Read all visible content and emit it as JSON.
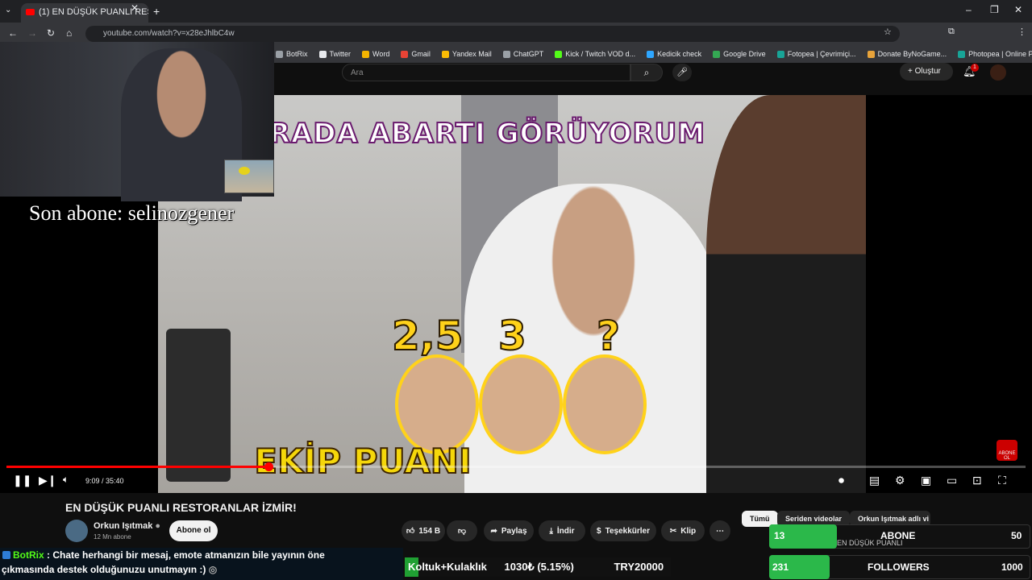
{
  "browser": {
    "tab_title": "(1) EN DÜŞÜK PUANLI REST",
    "url": "youtube.com/watch?v=x28eJhlbC4w",
    "bookmarks": [
      {
        "label": "BotRix",
        "color": "#9aa0a6"
      },
      {
        "label": "Twitter",
        "color": "#e8eaed"
      },
      {
        "label": "Word",
        "color": "#f4b400"
      },
      {
        "label": "Gmail",
        "color": "#ea4335"
      },
      {
        "label": "Yandex Mail",
        "color": "#fbbc04"
      },
      {
        "label": "ChatGPT",
        "color": "#9aa0a6"
      },
      {
        "label": "Kick / Twitch VOD d...",
        "color": "#53fc18"
      },
      {
        "label": "Kedicik check",
        "color": "#2ea6ff"
      },
      {
        "label": "Google Drive",
        "color": "#34a853"
      },
      {
        "label": "Fotopea | Çevrimiçi...",
        "color": "#18a497"
      },
      {
        "label": "Donate ByNoGame...",
        "color": "#e8a33a"
      },
      {
        "label": "Photopea | Online P...",
        "color": "#18a497"
      }
    ]
  },
  "youtube": {
    "search_placeholder": "Ara",
    "create_label": "Oluştur",
    "notification_count": "1",
    "video": {
      "overlay_title": "BEN BURADA ABARTI GÖRÜYORUM",
      "scores": [
        "2,5",
        "3",
        "?"
      ],
      "banner": "EKİP PUANI",
      "watermark": "ABONE OL",
      "time": "9:09 / 35:40",
      "progress": 0.257
    },
    "title": "EN DÜŞÜK PUANLI RESTORANLAR İZMİR!",
    "channel": "Orkun Işıtmak",
    "subscribers": "12 Mn abone",
    "subscribe_label": "Abone ol",
    "like_count": "154 B",
    "share_label": "Paylaş",
    "download_label": "İndir",
    "thanks_label": "Teşekkürler",
    "clip_label": "Klip",
    "chips": [
      "Tümü",
      "Seriden videolar",
      "Orkun Işıtmak adlı vi"
    ]
  },
  "stream": {
    "last_sub": "Son abone: selinozgener",
    "chat_user": "BotRix",
    "chat_line1": ": Chate herhangi bir mesaj, emote atmanızın bile yayının öne",
    "chat_line2": "çıkmasında destek olduğunuzu unutmayın :)",
    "goal_name": "Koltuk+Kulaklık",
    "goal_amount": "1030₺ (5.15%)",
    "goal_target": "TRY20000",
    "goal_progress": 0.0515,
    "sub_goal": {
      "current": "13",
      "label": "ABONE",
      "target": "50",
      "progress": 0.26
    },
    "follower_goal": {
      "current": "231",
      "label": "FOLLOWERS",
      "target": "1000",
      "progress": 0.231
    },
    "hidden_video_title": "EN DÜŞÜK PUANLI"
  },
  "colors": {
    "accent": "#ff0000",
    "goal_green": "#2bb84a",
    "score_yellow": "#ffd21a"
  }
}
